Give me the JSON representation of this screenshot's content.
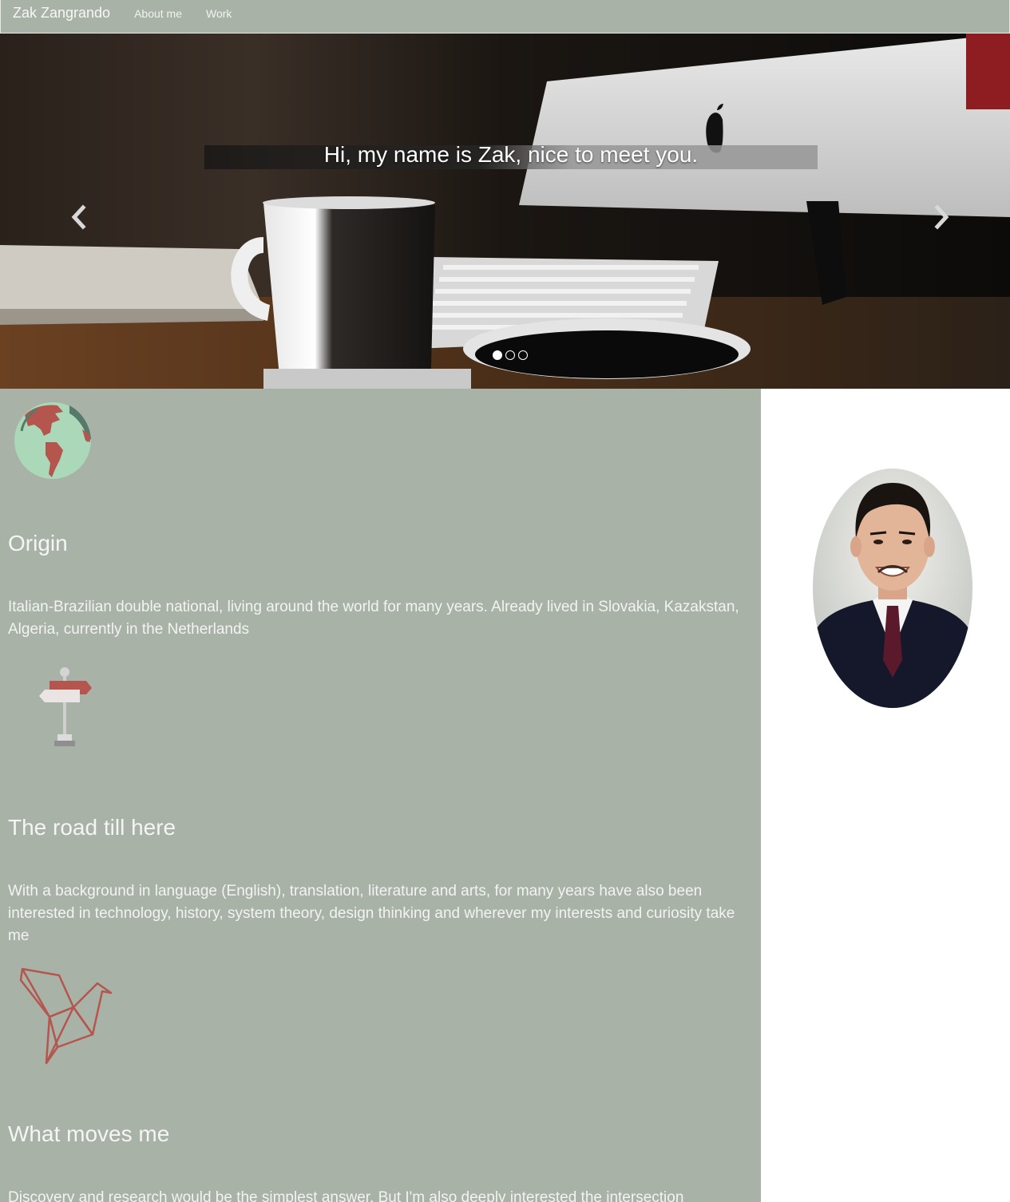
{
  "navbar": {
    "brand": "Zak Zangrando",
    "links": [
      "About me",
      "Work"
    ],
    "background": "#a8b2a6"
  },
  "carousel": {
    "caption": "Hi, my name is Zak, nice to meet you.",
    "prev_icon": "chevron-left-icon",
    "next_icon": "chevron-right-icon",
    "slide_count": 3,
    "active_slide": 1
  },
  "about": {
    "sections": [
      {
        "icon": "globe-icon",
        "title": "Origin",
        "text": "Italian-Brazilian double national, living around the world for many years. Already lived in Slovakia, Kazakstan, Algeria, currently in the Netherlands"
      },
      {
        "icon": "signpost-icon",
        "title": "The road till here",
        "text": "With a background in language (English), translation, literature and arts, for many years have also been interested in technology, history, system theory, design thinking and wherever my interests and curiosity take me"
      },
      {
        "icon": "origami-bird-icon",
        "title": "What moves me",
        "text": "Discovery and research would be the simplest answer. But I'm also deeply interested the intersection"
      }
    ],
    "panel_color": "#a8b2a6",
    "accent_color": "#b5564e"
  }
}
